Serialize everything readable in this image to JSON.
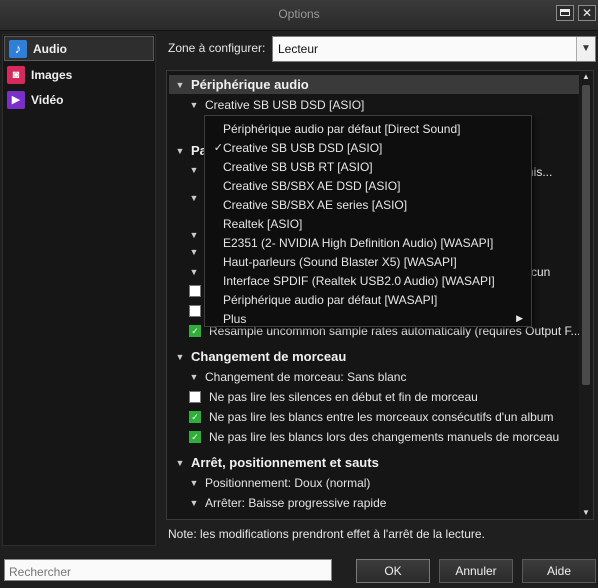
{
  "window": {
    "title": "Options",
    "maximize_glyph": "",
    "close_glyph": "✕"
  },
  "sidebar": {
    "items": [
      {
        "label": "Audio",
        "icon": "music-note-icon",
        "selected": true
      },
      {
        "label": "Images",
        "icon": "camera-icon",
        "selected": false
      },
      {
        "label": "Vidéo",
        "icon": "film-icon",
        "selected": false
      }
    ]
  },
  "zone": {
    "label": "Zone à configurer:",
    "value": "Lecteur"
  },
  "sections": {
    "audio_device": {
      "title": "Périphérique audio",
      "device_value": "Creative SB USB DSD [ASIO]"
    },
    "param": {
      "title_partial": "Pa",
      "row_truncated_1": "ne mis...",
      "row_truncated_2": "cun",
      "resample": "Resample uncommon sample rates automatically (requires Output F..."
    },
    "track_change": {
      "title": "Changement de morceau",
      "rows": [
        {
          "type": "combo",
          "label": "Changement de morceau: Sans blanc"
        },
        {
          "type": "check",
          "checked": false,
          "label": "Ne pas lire les silences en début et fin de morceau"
        },
        {
          "type": "check",
          "checked": true,
          "label": "Ne pas lire les blancs entre les morceaux consécutifs d'un album"
        },
        {
          "type": "check",
          "checked": true,
          "label": "Ne pas lire les blancs lors des changements manuels de morceau"
        }
      ]
    },
    "stop_seek": {
      "title": "Arrêt, positionnement et sauts",
      "rows": [
        {
          "label": "Positionnement: Doux (normal)"
        },
        {
          "label": "Arrêter: Baisse progressive rapide"
        }
      ]
    }
  },
  "device_menu": {
    "items": [
      {
        "label": "Périphérique audio par défaut [Direct Sound]",
        "checked": false
      },
      {
        "label": "Creative SB USB DSD [ASIO]",
        "checked": true
      },
      {
        "label": "Creative SB USB RT [ASIO]",
        "checked": false
      },
      {
        "label": "Creative SB/SBX AE DSD [ASIO]",
        "checked": false
      },
      {
        "label": "Creative SB/SBX AE series [ASIO]",
        "checked": false
      },
      {
        "label": "Realtek [ASIO]",
        "checked": false
      },
      {
        "label": "E2351 (2- NVIDIA High Definition Audio) [WASAPI]",
        "checked": false
      },
      {
        "label": "Haut-parleurs (Sound Blaster X5) [WASAPI]",
        "checked": false
      },
      {
        "label": "Interface SPDIF (Realtek USB2.0 Audio) [WASAPI]",
        "checked": false
      },
      {
        "label": "Périphérique audio par défaut [WASAPI]",
        "checked": false
      },
      {
        "label": "Plus",
        "checked": false,
        "submenu": true
      }
    ],
    "check_glyph": "✓",
    "submenu_glyph": "▶"
  },
  "note": "Note: les modifications prendront effet à l'arrêt de la lecture.",
  "search": {
    "placeholder": "Rechercher"
  },
  "buttons": {
    "ok": "OK",
    "cancel": "Annuler",
    "help": "Aide"
  },
  "colors": {
    "checkbox_on": "#2fae3a",
    "background": "#1f1f1f",
    "panel": "#151515"
  }
}
